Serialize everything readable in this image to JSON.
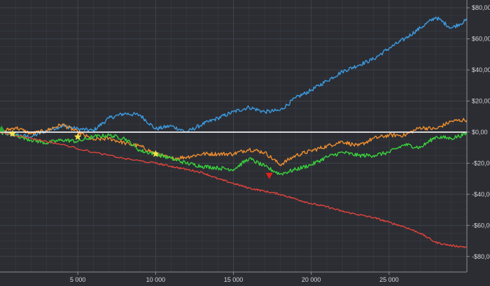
{
  "chart_data": {
    "type": "line",
    "title": "",
    "xlabel": "",
    "ylabel": "",
    "grid": true,
    "background": "#2b2d33",
    "grid_color": "#3f424a",
    "xlim": [
      0,
      30000
    ],
    "ylim": [
      -90,
      85
    ],
    "x_ticks": [
      5000,
      10000,
      15000,
      20000,
      25000
    ],
    "x_tick_labels": [
      "5 000",
      "10 000",
      "15 000",
      "20 000",
      "25 000"
    ],
    "y_ticks": [
      80,
      60,
      40,
      20,
      0,
      -20,
      -40,
      -60,
      -80
    ],
    "y_tick_labels": [
      "$80,00",
      "$60,00",
      "$40,00",
      "$20,00",
      "$0,00",
      "-$20,00",
      "-$40,00",
      "-$60,00",
      "-$80,00"
    ],
    "zero_line": {
      "value": 0,
      "color": "#ffffff"
    },
    "series": [
      {
        "color": "#3d9be0",
        "points": [
          [
            0,
            0
          ],
          [
            1000,
            -2
          ],
          [
            2000,
            -3
          ],
          [
            3000,
            1
          ],
          [
            4000,
            4
          ],
          [
            5000,
            2
          ],
          [
            6000,
            1
          ],
          [
            7000,
            9
          ],
          [
            8000,
            12
          ],
          [
            9000,
            11
          ],
          [
            10000,
            2
          ],
          [
            11000,
            4
          ],
          [
            12000,
            0
          ],
          [
            13000,
            5
          ],
          [
            14000,
            9
          ],
          [
            15000,
            13
          ],
          [
            16000,
            16
          ],
          [
            17000,
            13
          ],
          [
            18000,
            14
          ],
          [
            19000,
            22
          ],
          [
            20000,
            27
          ],
          [
            21000,
            33
          ],
          [
            22000,
            39
          ],
          [
            23000,
            43
          ],
          [
            24000,
            47
          ],
          [
            25000,
            54
          ],
          [
            26000,
            60
          ],
          [
            27000,
            67
          ],
          [
            28000,
            74
          ],
          [
            29000,
            67
          ],
          [
            30000,
            72
          ]
        ]
      },
      {
        "color": "#ef8e2e",
        "points": [
          [
            0,
            0
          ],
          [
            1000,
            3
          ],
          [
            2000,
            -1
          ],
          [
            3000,
            1
          ],
          [
            4000,
            5
          ],
          [
            5000,
            0
          ],
          [
            6000,
            -5
          ],
          [
            7000,
            -4
          ],
          [
            8000,
            -7
          ],
          [
            9000,
            -9
          ],
          [
            10000,
            -14
          ],
          [
            11000,
            -17
          ],
          [
            12000,
            -16
          ],
          [
            13000,
            -14
          ],
          [
            14000,
            -14
          ],
          [
            15000,
            -14
          ],
          [
            16000,
            -11
          ],
          [
            17000,
            -13
          ],
          [
            18000,
            -21
          ],
          [
            19000,
            -15
          ],
          [
            20000,
            -12
          ],
          [
            21000,
            -9
          ],
          [
            22000,
            -6
          ],
          [
            23000,
            -9
          ],
          [
            24000,
            -4
          ],
          [
            25000,
            -2
          ],
          [
            26000,
            -2
          ],
          [
            27000,
            3
          ],
          [
            28000,
            2
          ],
          [
            29000,
            7
          ],
          [
            30000,
            8
          ]
        ]
      },
      {
        "color": "#39d23c",
        "points": [
          [
            0,
            0
          ],
          [
            1000,
            -2
          ],
          [
            2000,
            -5
          ],
          [
            3000,
            -7
          ],
          [
            4000,
            -5
          ],
          [
            5000,
            -6
          ],
          [
            6000,
            -3
          ],
          [
            7000,
            -2
          ],
          [
            8000,
            -4
          ],
          [
            9000,
            -12
          ],
          [
            10000,
            -14
          ],
          [
            11000,
            -17
          ],
          [
            12000,
            -20
          ],
          [
            13000,
            -22
          ],
          [
            14000,
            -23
          ],
          [
            15000,
            -24
          ],
          [
            16000,
            -17
          ],
          [
            17000,
            -22
          ],
          [
            18000,
            -27
          ],
          [
            19000,
            -24
          ],
          [
            20000,
            -21
          ],
          [
            21000,
            -16
          ],
          [
            22000,
            -13
          ],
          [
            23000,
            -15
          ],
          [
            24000,
            -15
          ],
          [
            25000,
            -13
          ],
          [
            26000,
            -8
          ],
          [
            27000,
            -10
          ],
          [
            28000,
            -3
          ],
          [
            29000,
            -4
          ],
          [
            30000,
            -1
          ]
        ]
      },
      {
        "color": "#e0433b",
        "points": [
          [
            0,
            0
          ],
          [
            2000,
            -4
          ],
          [
            4000,
            -8
          ],
          [
            6000,
            -13
          ],
          [
            8000,
            -17
          ],
          [
            10000,
            -20
          ],
          [
            11000,
            -22
          ],
          [
            12000,
            -24
          ],
          [
            13000,
            -26
          ],
          [
            14000,
            -30
          ],
          [
            15000,
            -33
          ],
          [
            16000,
            -36
          ],
          [
            17000,
            -38
          ],
          [
            18000,
            -40
          ],
          [
            19000,
            -43
          ],
          [
            20000,
            -46
          ],
          [
            21000,
            -48
          ],
          [
            22000,
            -51
          ],
          [
            23000,
            -53
          ],
          [
            24000,
            -55
          ],
          [
            25000,
            -58
          ],
          [
            26000,
            -61
          ],
          [
            27000,
            -65
          ],
          [
            28000,
            -71
          ],
          [
            29000,
            -73
          ],
          [
            30000,
            -74
          ]
        ]
      }
    ],
    "markers": [
      {
        "shape": "triangle-up",
        "color": "#2fa43a",
        "x": 100,
        "y": 2
      },
      {
        "shape": "star",
        "color": "#f2e24a",
        "x": 800,
        "y": -1
      },
      {
        "shape": "star",
        "color": "#f2e24a",
        "x": 5000,
        "y": -3
      },
      {
        "shape": "star",
        "color": "#f2e24a",
        "x": 10000,
        "y": -14
      },
      {
        "shape": "triangle-down",
        "color": "#e0231b",
        "x": 17300,
        "y": -28
      }
    ]
  }
}
